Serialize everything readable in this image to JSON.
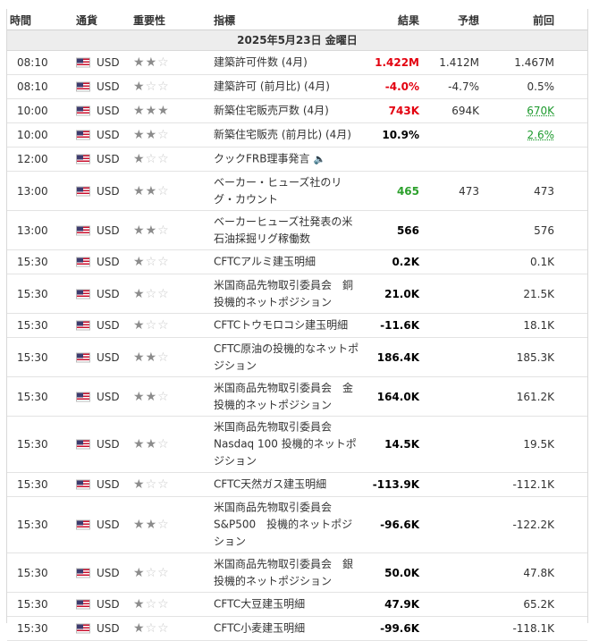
{
  "header": {
    "time": "時間",
    "currency": "通貨",
    "importance": "重要性",
    "event": "指標",
    "actual": "結果",
    "forecast": "予想",
    "previous": "前回"
  },
  "date_label": "2025年5月23日 金曜日",
  "colors": {
    "negative": "#e3000f",
    "positive": "#2ca02c",
    "star_on": "#8c8c8c",
    "star_off": "#c9c9c9"
  },
  "rows": [
    {
      "time": "08:10",
      "currency": "USD",
      "stars": 2,
      "event": "建築許可件数 (4月)",
      "actual": "1.422M",
      "actual_color": "red",
      "forecast": "1.412M",
      "previous": "1.467M",
      "lines": 1
    },
    {
      "time": "08:10",
      "currency": "USD",
      "stars": 1,
      "event": "建築許可 (前月比) (4月)",
      "actual": "-4.0%",
      "actual_color": "red",
      "forecast": "-4.7%",
      "previous": "0.5%",
      "lines": 1
    },
    {
      "time": "10:00",
      "currency": "USD",
      "stars": 3,
      "event": "新築住宅販売戸数 (4月)",
      "actual": "743K",
      "actual_color": "red",
      "forecast": "694K",
      "previous": "670K",
      "previous_color": "green",
      "lines": 1
    },
    {
      "time": "10:00",
      "currency": "USD",
      "stars": 2,
      "event": "新築住宅販売 (前月比) (4月)",
      "actual": "10.9%",
      "actual_color": "",
      "forecast": "",
      "previous": "2.6%",
      "previous_color": "green",
      "lines": 1
    },
    {
      "time": "12:00",
      "currency": "USD",
      "stars": 1,
      "event": "クックFRB理事発言",
      "speaker": true,
      "actual": "",
      "forecast": "",
      "previous": "",
      "lines": 1
    },
    {
      "time": "13:00",
      "currency": "USD",
      "stars": 2,
      "event": "ベーカー・ヒューズ社のリグ・カウント",
      "actual": "465",
      "actual_color": "green",
      "forecast": "473",
      "previous": "473",
      "lines": 2
    },
    {
      "time": "13:00",
      "currency": "USD",
      "stars": 2,
      "event": "ベーカーヒューズ社発表の米石油採掘リグ稼働数",
      "actual": "566",
      "actual_color": "",
      "forecast": "",
      "previous": "576",
      "lines": 2
    },
    {
      "time": "15:30",
      "currency": "USD",
      "stars": 1,
      "event": "CFTCアルミ建玉明細",
      "actual": "0.2K",
      "actual_color": "",
      "forecast": "",
      "previous": "0.1K",
      "lines": 1
    },
    {
      "time": "15:30",
      "currency": "USD",
      "stars": 1,
      "event": "米国商品先物取引委員会　銅投機的ネットポジション",
      "actual": "21.0K",
      "actual_color": "",
      "forecast": "",
      "previous": "21.5K",
      "lines": 2
    },
    {
      "time": "15:30",
      "currency": "USD",
      "stars": 1,
      "event": "CFTCトウモロコシ建玉明細",
      "actual": "-11.6K",
      "actual_color": "",
      "forecast": "",
      "previous": "18.1K",
      "lines": 1
    },
    {
      "time": "15:30",
      "currency": "USD",
      "stars": 2,
      "event": "CFTC原油の投機的なネットポジション",
      "actual": "186.4K",
      "actual_color": "",
      "forecast": "",
      "previous": "185.3K",
      "lines": 2
    },
    {
      "time": "15:30",
      "currency": "USD",
      "stars": 2,
      "event": "米国商品先物取引委員会　金投機的ネットポジション",
      "actual": "164.0K",
      "actual_color": "",
      "forecast": "",
      "previous": "161.2K",
      "lines": 2
    },
    {
      "time": "15:30",
      "currency": "USD",
      "stars": 2,
      "event": "米国商品先物取引委員会 Nasdaq 100 投機的ネットポジション",
      "actual": "14.5K",
      "actual_color": "",
      "forecast": "",
      "previous": "19.5K",
      "lines": 3
    },
    {
      "time": "15:30",
      "currency": "USD",
      "stars": 1,
      "event": "CFTC天然ガス建玉明細",
      "actual": "-113.9K",
      "actual_color": "",
      "forecast": "",
      "previous": "-112.1K",
      "lines": 1
    },
    {
      "time": "15:30",
      "currency": "USD",
      "stars": 2,
      "event": "米国商品先物取引委員会 S&P500　投機的ネットポジション",
      "actual": "-96.6K",
      "actual_color": "",
      "forecast": "",
      "previous": "-122.2K",
      "lines": 3
    },
    {
      "time": "15:30",
      "currency": "USD",
      "stars": 1,
      "event": "米国商品先物取引委員会　銀投機的ネットポジション",
      "actual": "50.0K",
      "actual_color": "",
      "forecast": "",
      "previous": "47.8K",
      "lines": 2
    },
    {
      "time": "15:30",
      "currency": "USD",
      "stars": 1,
      "event": "CFTC大豆建玉明細",
      "actual": "47.9K",
      "actual_color": "",
      "forecast": "",
      "previous": "65.2K",
      "lines": 1
    },
    {
      "time": "15:30",
      "currency": "USD",
      "stars": 1,
      "event": "CFTC小麦建玉明細",
      "actual": "-99.6K",
      "actual_color": "",
      "forecast": "",
      "previous": "-118.1K",
      "lines": 1
    }
  ]
}
